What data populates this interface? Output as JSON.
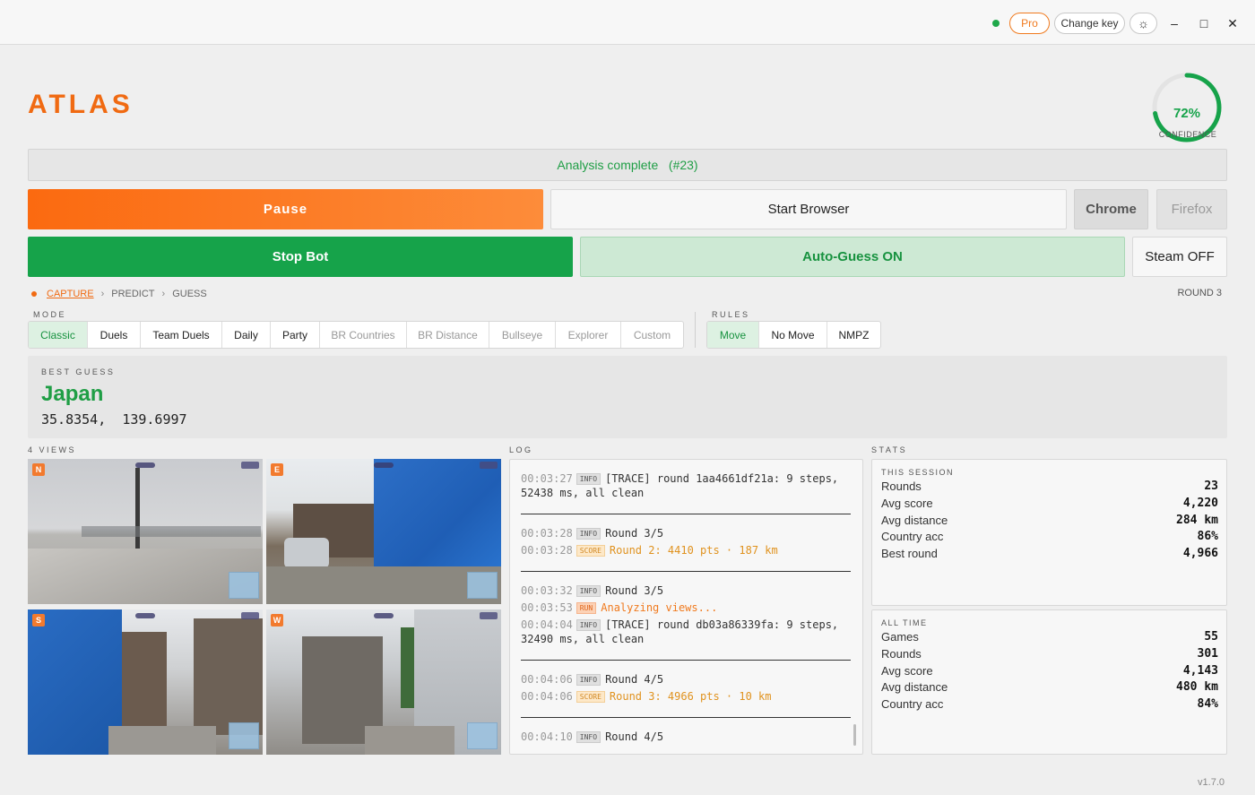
{
  "titlebar": {
    "pro_label": "Pro",
    "change_key_label": "Change key",
    "theme_icon": "☼",
    "minimize_icon": "–",
    "maximize_icon": "□",
    "close_icon": "✕"
  },
  "app": {
    "logo": "ATLAS",
    "version": "v1.7.0"
  },
  "confidence": {
    "value_label": "72%",
    "percent": 72,
    "label": "CONFIDENCE"
  },
  "status": {
    "text": "Analysis complete   (#23)"
  },
  "controls": {
    "pause": "Pause",
    "start_browser": "Start Browser",
    "chrome": "Chrome",
    "firefox": "Firefox",
    "stop_bot": "Stop Bot",
    "auto_guess": "Auto-Guess ON",
    "steam": "Steam OFF"
  },
  "pipeline": {
    "steps": [
      "CAPTURE",
      "PREDICT",
      "GUESS"
    ],
    "round": "ROUND 3"
  },
  "mode": {
    "label": "MODE",
    "options": [
      "Classic",
      "Duels",
      "Team Duels",
      "Daily",
      "Party",
      "BR Countries",
      "BR Distance",
      "Bullseye",
      "Explorer",
      "Custom"
    ],
    "selected": "Classic"
  },
  "rules": {
    "label": "RULES",
    "options": [
      "Move",
      "No Move",
      "NMPZ"
    ],
    "selected": "Move"
  },
  "best_guess": {
    "label": "BEST GUESS",
    "country": "Japan",
    "lat": "35.8354,",
    "lng": "139.6997"
  },
  "views": {
    "label": "4 VIEWS",
    "items": [
      {
        "dir": "N"
      },
      {
        "dir": "E"
      },
      {
        "dir": "S"
      },
      {
        "dir": "W"
      }
    ]
  },
  "log": {
    "label": "LOG",
    "lines": [
      {
        "ts": "00:03:27",
        "tag": "INFO",
        "msg": "[TRACE] round 1aa4661df21a: 9 steps,"
      },
      {
        "ts": "",
        "tag": "",
        "msg": "52438 ms, all clean"
      },
      {
        "ts": "00:03:28",
        "tag": "INFO",
        "msg": "Round 3/5"
      },
      {
        "ts": "00:03:28",
        "tag": "SCORE",
        "msg": "Round 2: 4410 pts · 187 km"
      },
      {
        "ts": "00:03:32",
        "tag": "INFO",
        "msg": "Round 3/5"
      },
      {
        "ts": "00:03:53",
        "tag": "RUN",
        "msg": "Analyzing views..."
      },
      {
        "ts": "00:04:04",
        "tag": "INFO",
        "msg": "[TRACE] round db03a86339fa: 9 steps,"
      },
      {
        "ts": "",
        "tag": "",
        "msg": "32490 ms, all clean"
      },
      {
        "ts": "00:04:06",
        "tag": "INFO",
        "msg": "Round 4/5"
      },
      {
        "ts": "00:04:06",
        "tag": "SCORE",
        "msg": "Round 3: 4966 pts · 10 km"
      },
      {
        "ts": "00:04:10",
        "tag": "INFO",
        "msg": "Round 4/5"
      }
    ]
  },
  "stats": {
    "label": "STATS",
    "session": {
      "label": "THIS SESSION",
      "rows": [
        {
          "k": "Rounds",
          "v": "23"
        },
        {
          "k": "Avg score",
          "v": "4,220"
        },
        {
          "k": "Avg distance",
          "v": "284 km"
        },
        {
          "k": "Country acc",
          "v": "86%"
        },
        {
          "k": "Best round",
          "v": "4,966"
        }
      ]
    },
    "alltime": {
      "label": "ALL TIME",
      "rows": [
        {
          "k": "Games",
          "v": "55"
        },
        {
          "k": "Rounds",
          "v": "301"
        },
        {
          "k": "Avg score",
          "v": "4,143"
        },
        {
          "k": "Avg distance",
          "v": "480 km"
        },
        {
          "k": "Country acc",
          "v": "84%"
        }
      ]
    }
  },
  "colors": {
    "accent": "#f06a12",
    "success": "#16a34a",
    "score": "#e0921e"
  }
}
